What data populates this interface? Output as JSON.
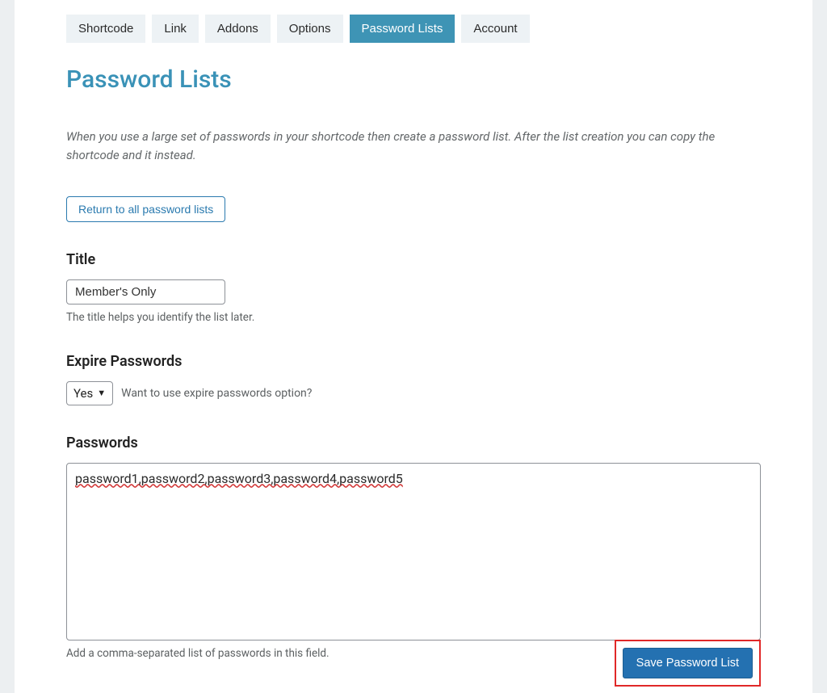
{
  "tabs": {
    "items": [
      {
        "label": "Shortcode",
        "active": false
      },
      {
        "label": "Link",
        "active": false
      },
      {
        "label": "Addons",
        "active": false
      },
      {
        "label": "Options",
        "active": false
      },
      {
        "label": "Password Lists",
        "active": true
      },
      {
        "label": "Account",
        "active": false
      }
    ]
  },
  "page": {
    "title": "Password Lists",
    "description": "When you use a large set of passwords in your shortcode then create a password list. After the list creation you can copy the shortcode and it instead."
  },
  "return_button": {
    "label": "Return to all password lists"
  },
  "title_field": {
    "label": "Title",
    "value": "Member's Only",
    "help": "The title helps you identify the list later."
  },
  "expire_field": {
    "label": "Expire Passwords",
    "value": "Yes",
    "help": "Want to use expire passwords option?"
  },
  "passwords_field": {
    "label": "Passwords",
    "value": "password1,password2,password3,password4,password5",
    "help": "Add a comma-separated list of passwords in this field."
  },
  "save_button": {
    "label": "Save Password List"
  }
}
